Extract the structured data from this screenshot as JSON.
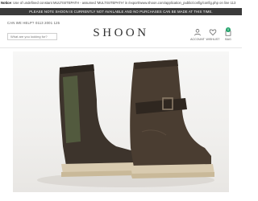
{
  "notice": {
    "label": "Notice",
    "text": ": Use of undefined constant MULTISITEPATH - assumed 'MULTISITEPATH' in /export/www.shoon.com/application_public/config/config.php on line 113"
  },
  "announcement": "PLEASE NOTE SHOON IS CURRENTLY NOT AVAILABLE AND NO PURCHASES CAN BE MADE AT THIS TIME.",
  "help_line": "CAN WE HELP? 0113 2001 125",
  "logo": "SHOON",
  "search": {
    "placeholder": "What are you looking for?",
    "value": ""
  },
  "header_icons": [
    {
      "label": "ACCOUNT",
      "icon": "person-icon"
    },
    {
      "label": "WISHLIST",
      "icon": "heart-icon"
    },
    {
      "label": "BAG",
      "icon": "bag-icon",
      "count": "0"
    }
  ],
  "colors": {
    "announcement_bg": "#3a3a3a",
    "bag_badge": "#22a36a",
    "boot_upper": "#4a3d31",
    "boot_sole": "#d9cbb0"
  }
}
